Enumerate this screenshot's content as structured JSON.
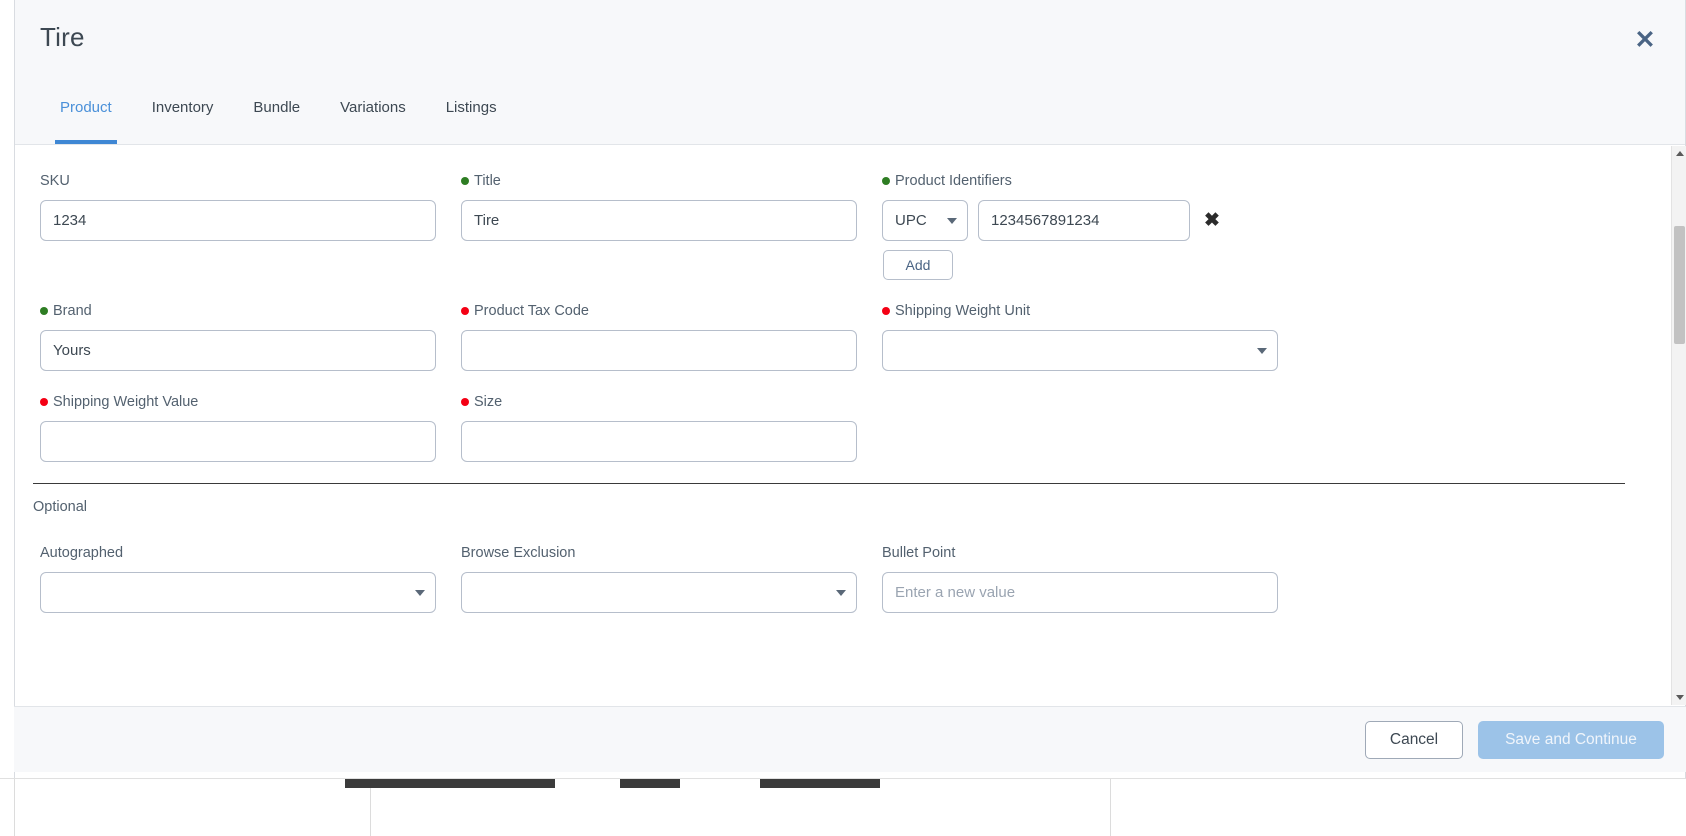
{
  "modal": {
    "title": "Tire",
    "close_icon": "close-icon"
  },
  "tabs": [
    {
      "label": "Product",
      "active": true
    },
    {
      "label": "Inventory",
      "active": false
    },
    {
      "label": "Bundle",
      "active": false
    },
    {
      "label": "Variations",
      "active": false
    },
    {
      "label": "Listings",
      "active": false
    }
  ],
  "form": {
    "sku": {
      "label": "SKU",
      "value": "1234",
      "status": "none",
      "placeholder": ""
    },
    "title": {
      "label": "Title",
      "value": "Tire",
      "status": "green",
      "placeholder": ""
    },
    "product_identifiers": {
      "label": "Product Identifiers",
      "status": "green",
      "type_value": "UPC",
      "id_value": "1234567891234",
      "remove_icon": "✖",
      "add_label": "Add"
    },
    "brand": {
      "label": "Brand",
      "value": "Yours",
      "status": "green",
      "placeholder": ""
    },
    "product_tax_code": {
      "label": "Product Tax Code",
      "value": "",
      "status": "red",
      "placeholder": ""
    },
    "shipping_weight_unit": {
      "label": "Shipping Weight Unit",
      "value": "",
      "status": "red"
    },
    "shipping_weight_value": {
      "label": "Shipping Weight Value",
      "value": "",
      "status": "red",
      "placeholder": ""
    },
    "size": {
      "label": "Size",
      "value": "",
      "status": "red",
      "placeholder": ""
    }
  },
  "optional": {
    "section_label": "Optional",
    "autographed": {
      "label": "Autographed",
      "value": "",
      "status": "none"
    },
    "browse_exclusion": {
      "label": "Browse Exclusion",
      "value": "",
      "status": "none"
    },
    "bullet_point": {
      "label": "Bullet Point",
      "value": "",
      "status": "none",
      "placeholder": "Enter a new value"
    }
  },
  "footer": {
    "cancel_label": "Cancel",
    "save_label": "Save and Continue"
  },
  "colors": {
    "accent": "#3f87d4",
    "required": "#f40014",
    "filled": "#2e7d23",
    "header_bg": "#f7f8fa",
    "border": "#b6becb"
  }
}
